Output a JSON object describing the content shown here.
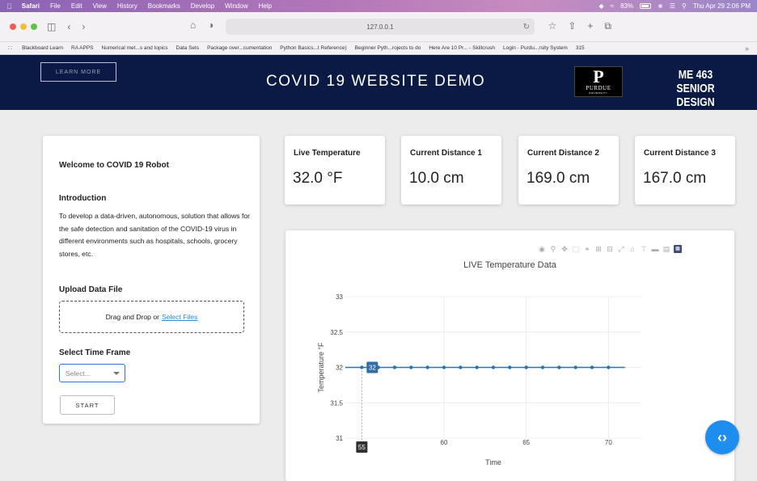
{
  "menubar": {
    "app": "Safari",
    "items": [
      "File",
      "Edit",
      "View",
      "History",
      "Bookmarks",
      "Develop",
      "Window",
      "Help"
    ],
    "battery": "83%",
    "clock": "Thu Apr 29  2:06 PM"
  },
  "browser": {
    "url": "127.0.0.1",
    "bookmarks": [
      "Blackboard Learn",
      "RA APPS",
      "Numerical met...s and topics",
      "Data Sets",
      "Package over...cumentation",
      "Python Basics...t Reference)",
      "Beginner Pyth...rojects to do",
      "Here Are 10 Pr... - Skillcrush",
      "Login - Purdu...rsity System",
      "315"
    ]
  },
  "header": {
    "learn_more": "LEARN MORE",
    "title": "COVID 19 WEBSITE DEMO",
    "logo_name": "PURDUE",
    "logo_sub": "UNIVERSITY.",
    "course_line1": "ME 463",
    "course_line2": "SENIOR DESIGN"
  },
  "sidebar": {
    "welcome": "Welcome to COVID 19 Robot",
    "intro_heading": "Introduction",
    "intro_text": "To develop a data-driven, autonomous, solution that allows for the safe detection and sanitation of the COVID-19 virus in different environments such as hospitals, schools, grocery stores, etc.",
    "upload_heading": "Upload Data File",
    "drop_text": "Drag and Drop or",
    "drop_link": "Select Files",
    "time_heading": "Select Time Frame",
    "select_placeholder": "Select...",
    "start_label": "START"
  },
  "stats": [
    {
      "label": "Live Temperature",
      "value": "32.0 °F"
    },
    {
      "label": "Current Distance 1",
      "value": "10.0 cm"
    },
    {
      "label": "Current Distance 2",
      "value": "169.0 cm"
    },
    {
      "label": "Current Distance 3",
      "value": "167.0 cm"
    }
  ],
  "chart_data": {
    "type": "line",
    "title": "LIVE Temperature Data",
    "xlabel": "Time",
    "ylabel": "Temperature °F",
    "x": [
      55,
      56,
      57,
      58,
      59,
      60,
      61,
      62,
      63,
      64,
      65,
      66,
      67,
      68,
      69,
      70
    ],
    "y": [
      32,
      32,
      32,
      32,
      32,
      32,
      32,
      32,
      32,
      32,
      32,
      32,
      32,
      32,
      32,
      32
    ],
    "xlim": [
      54,
      72
    ],
    "ylim": [
      31,
      33
    ],
    "xticks": [
      60,
      65,
      70
    ],
    "yticks": [
      31,
      31.5,
      32,
      32.5,
      33
    ],
    "hover_y_label": "32",
    "hover_x_label": "55",
    "line_color": "#1f77b4",
    "grid": true
  }
}
